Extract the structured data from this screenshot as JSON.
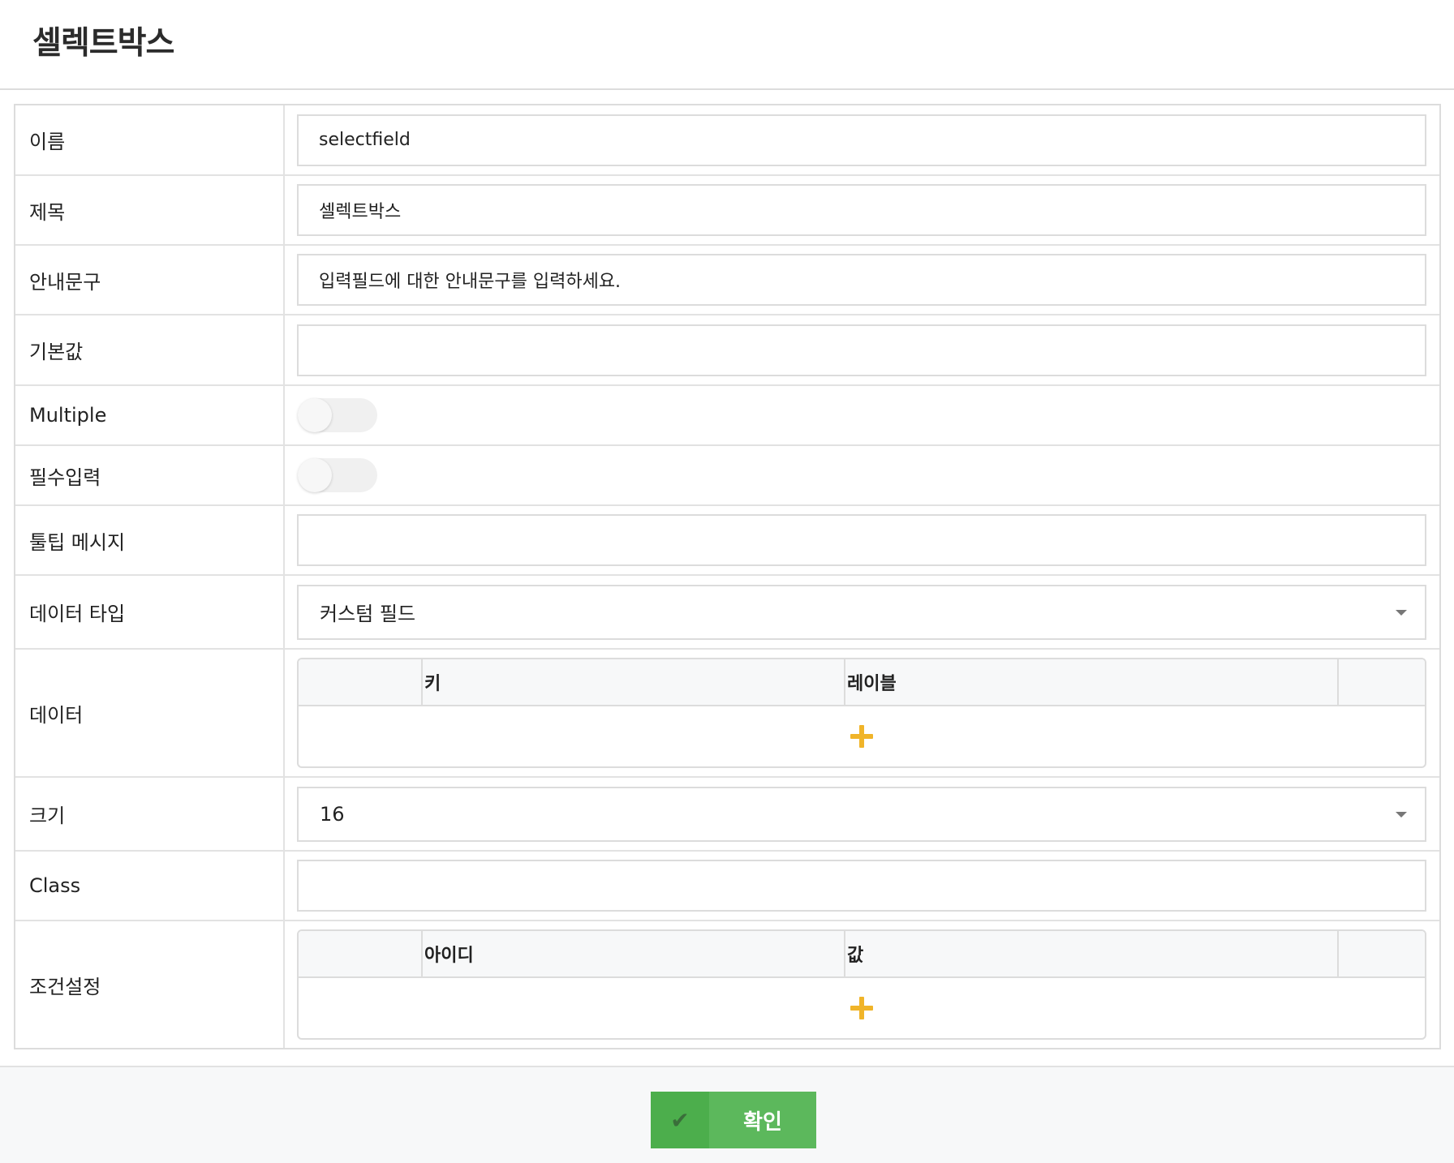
{
  "header": {
    "title": "셀렉트박스"
  },
  "form": {
    "name": {
      "label": "이름",
      "value": "selectfield"
    },
    "title": {
      "label": "제목",
      "value": "셀렉트박스"
    },
    "guide": {
      "label": "안내문구",
      "value": "입력필드에 대한 안내문구를 입력하세요."
    },
    "default_value": {
      "label": "기본값",
      "value": ""
    },
    "multiple": {
      "label": "Multiple",
      "on": false
    },
    "required": {
      "label": "필수입력",
      "on": false
    },
    "tooltip": {
      "label": "툴팁 메시지",
      "value": ""
    },
    "data_type": {
      "label": "데이터 타입",
      "selected": "커스텀 필드"
    },
    "data": {
      "label": "데이터",
      "columns": [
        "키",
        "레이블"
      ]
    },
    "size": {
      "label": "크기",
      "selected": "16"
    },
    "class": {
      "label": "Class",
      "value": ""
    },
    "conditions": {
      "label": "조건설정",
      "columns": [
        "아이디",
        "값"
      ]
    }
  },
  "footer": {
    "confirm_label": "확인",
    "confirm_icon": "check-icon"
  },
  "colors": {
    "accent_green": "#5cb85c",
    "plus_yellow": "#f0b429"
  }
}
